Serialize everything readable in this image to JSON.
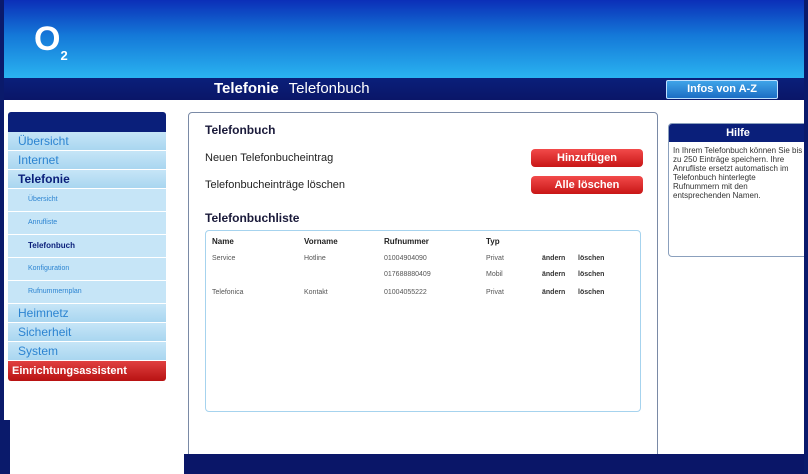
{
  "brand": {
    "logo_main": "O",
    "logo_sub": "2"
  },
  "header": {
    "crumb_section": "Telefonie",
    "crumb_page": "Telefonbuch",
    "az_button": "Infos von A-Z"
  },
  "sidebar": {
    "items": [
      {
        "label": "Übersicht"
      },
      {
        "label": "Internet"
      },
      {
        "label": "Telefonie"
      },
      {
        "label": "Übersicht"
      },
      {
        "label": "Anrufliste"
      },
      {
        "label": "Telefonbuch"
      },
      {
        "label": "Konfiguration"
      },
      {
        "label": "Rufnummernplan"
      },
      {
        "label": "Heimnetz"
      },
      {
        "label": "Sicherheit"
      },
      {
        "label": "System"
      }
    ],
    "wizard": "Einrichtungsassistent"
  },
  "main": {
    "title": "Telefonbuch",
    "new_entry_label": "Neuen Telefonbucheintrag",
    "add_button": "Hinzufügen",
    "delete_all_label": "Telefonbucheinträge löschen",
    "delete_all_button": "Alle löschen",
    "list_title": "Telefonbuchliste",
    "columns": {
      "name": "Name",
      "vorname": "Vorname",
      "rufnummer": "Rufnummer",
      "typ": "Typ"
    },
    "rows": [
      {
        "name": "Service",
        "vorname": "Hotline",
        "rufnummer": "01004904090",
        "typ": "Privat",
        "edit": "ändern",
        "delete": "löschen"
      },
      {
        "name": "",
        "vorname": "",
        "rufnummer": "017688880409",
        "typ": "Mobil",
        "edit": "ändern",
        "delete": "löschen"
      },
      {
        "name": "Telefonica",
        "vorname": "Kontakt",
        "rufnummer": "01004055222",
        "typ": "Privat",
        "edit": "ändern",
        "delete": "löschen"
      }
    ]
  },
  "help": {
    "title": "Hilfe",
    "text": "In Ihrem Telefonbuch können Sie bis zu 250 Einträge speichern. Ihre Anrufliste ersetzt automatisch im Telefonbuch hinterlegte Rufnummern mit den entsprechenden Namen."
  }
}
